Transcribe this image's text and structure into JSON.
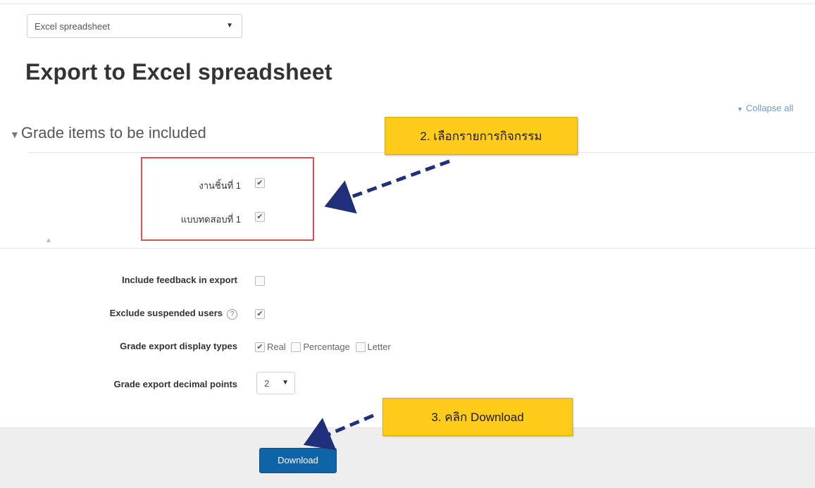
{
  "export_format": {
    "value": "Excel spreadsheet"
  },
  "page_title": "Export to Excel spreadsheet",
  "collapse_all": "Collapse all",
  "section": {
    "legend": "Grade items to be included"
  },
  "grade_items": [
    {
      "label": "งานชิ้นที่ 1",
      "checked": true
    },
    {
      "label": "แบบทดสอบที่ 1",
      "checked": true
    }
  ],
  "options": {
    "include_feedback": {
      "label": "Include feedback in export",
      "checked": false
    },
    "exclude_suspended": {
      "label": "Exclude suspended users",
      "checked": true
    },
    "display_types": {
      "label": "Grade export display types",
      "choices": [
        {
          "label": "Real",
          "checked": true
        },
        {
          "label": "Percentage",
          "checked": false
        },
        {
          "label": "Letter",
          "checked": false
        }
      ]
    },
    "decimal_points": {
      "label": "Grade export decimal points",
      "value": "2"
    }
  },
  "callouts": {
    "step2": "2. เลือกรายการกิจกรรม",
    "step3": "3. คลิก Download"
  },
  "download_label": "Download",
  "colors": {
    "accent": "#0f64a8",
    "callout": "#ffcc1a",
    "highlight_box": "#d9534f",
    "arrow": "#1f2f7a"
  }
}
